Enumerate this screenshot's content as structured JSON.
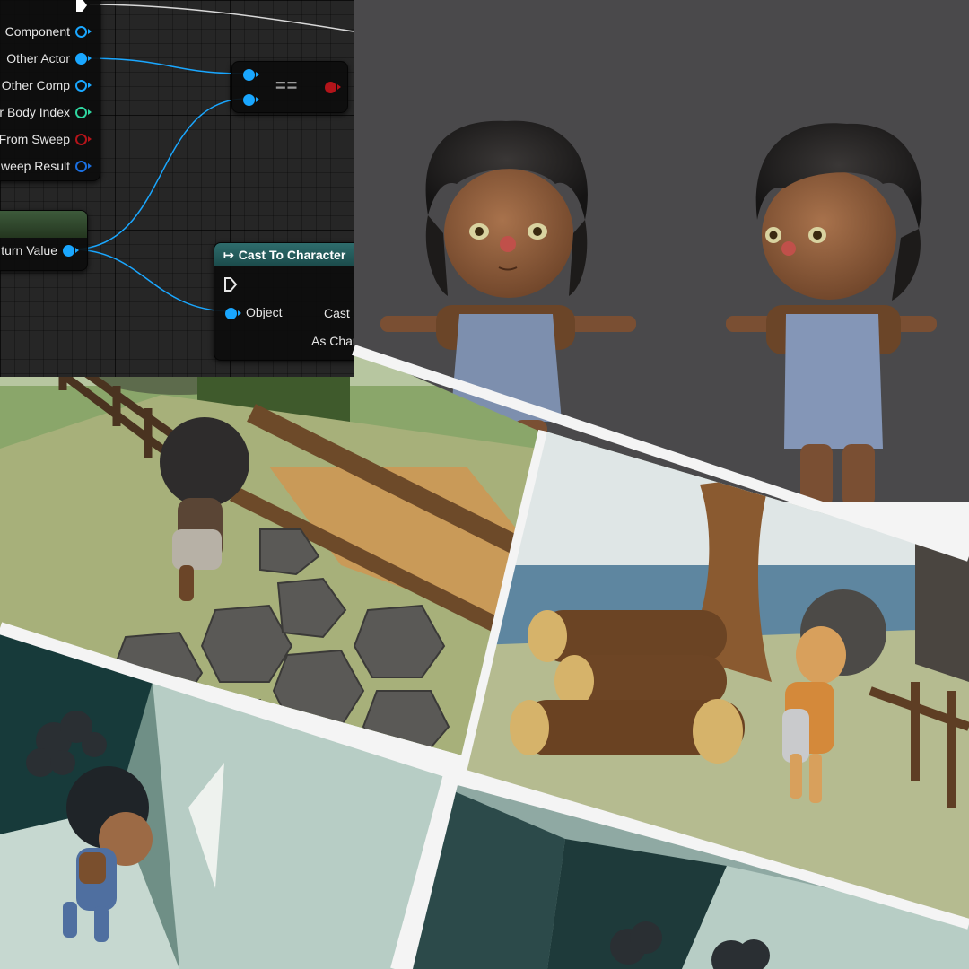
{
  "blueprint": {
    "overlap_event_pins": [
      {
        "label": "Component",
        "pin": "blue"
      },
      {
        "label": "Other Actor",
        "pin": "blue-filled"
      },
      {
        "label": "Other Comp",
        "pin": "blue"
      },
      {
        "label": "r Body Index",
        "pin": "green"
      },
      {
        "label": "From Sweep",
        "pin": "red"
      },
      {
        "label": "weep Result",
        "pin": "navy"
      }
    ],
    "equals_node": {
      "operator": "=="
    },
    "return_node": {
      "output_label": "turn Value"
    },
    "cast_node": {
      "title": "Cast To Character",
      "object_label": "Object",
      "cast_failed_label": "Cast",
      "as_label": "As Char"
    },
    "colors": {
      "object_pin": "#1aa7ff",
      "integer_pin": "#2fd6a0",
      "bool_pin": "#b3141a",
      "struct_pin": "#1b6fe0",
      "cast_header": "#2e6c6c"
    }
  },
  "scenes": {
    "character_preview": {
      "background": "#4a494b",
      "pose": "T-pose",
      "count": 2
    },
    "garden": {
      "description_icon": "character-near-wooden-fence"
    },
    "logs": {
      "description_icon": "character-near-log-pile"
    },
    "cave": {
      "description_icon": "character-running-in-cave"
    }
  }
}
